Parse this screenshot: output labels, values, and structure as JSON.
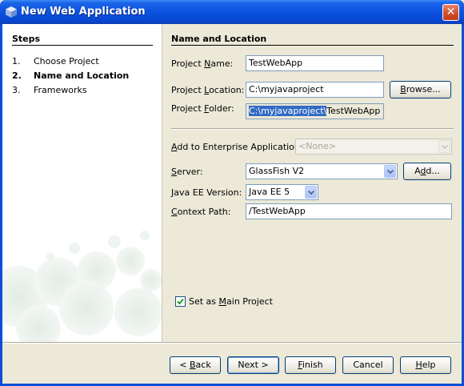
{
  "window": {
    "title": "New Web Application",
    "close_symbol": "✕"
  },
  "steps": {
    "title": "Steps",
    "items": [
      {
        "num": "1.",
        "label": "Choose Project",
        "current": false
      },
      {
        "num": "2.",
        "label": "Name and Location",
        "current": true
      },
      {
        "num": "3.",
        "label": "Frameworks",
        "current": false
      }
    ]
  },
  "form": {
    "section_title": "Name and Location",
    "project_name": {
      "label_pre": "Project ",
      "label_mn": "N",
      "label_post": "ame:",
      "value": "TestWebApp"
    },
    "project_location": {
      "label_pre": "Project ",
      "label_mn": "L",
      "label_post": "ocation:",
      "value": "C:\\myjavaproject"
    },
    "browse_button": {
      "pre": "",
      "mn": "B",
      "post": "rowse..."
    },
    "project_folder": {
      "label_pre": "Project ",
      "label_mn": "F",
      "label_post": "older:",
      "value_selected": "C:\\myjavaproject\\",
      "value_rest": "TestWebApp"
    },
    "enterprise_app": {
      "label_pre": "",
      "label_mn": "A",
      "label_post": "dd to Enterprise Application:",
      "value": "<None>"
    },
    "server": {
      "label_pre": "",
      "label_mn": "S",
      "label_post": "erver:",
      "value": "GlassFish V2"
    },
    "add_button": {
      "pre": "A",
      "mn": "d",
      "post": "d..."
    },
    "java_ee": {
      "label_pre": "",
      "label_mn": "J",
      "label_post": "ava EE Version:",
      "value": "Java EE 5"
    },
    "context_path": {
      "label_pre": "",
      "label_mn": "C",
      "label_post": "ontext Path:",
      "value": "/TestWebApp"
    },
    "main_project": {
      "label_pre": "Set as ",
      "label_mn": "M",
      "label_post": "ain Project",
      "checked": true
    }
  },
  "buttons": {
    "back": {
      "pre": "< ",
      "mn": "B",
      "post": "ack"
    },
    "next": {
      "pre": "Next >",
      "mn": "",
      "post": ""
    },
    "finish": {
      "pre": "",
      "mn": "F",
      "post": "inish"
    },
    "cancel": {
      "pre": "Cancel",
      "mn": "",
      "post": ""
    },
    "help": {
      "pre": "",
      "mn": "H",
      "post": "elp"
    }
  },
  "colors": {
    "title_bar": "#0a52df",
    "selection": "#316ac5",
    "panel": "#ece9d8"
  }
}
